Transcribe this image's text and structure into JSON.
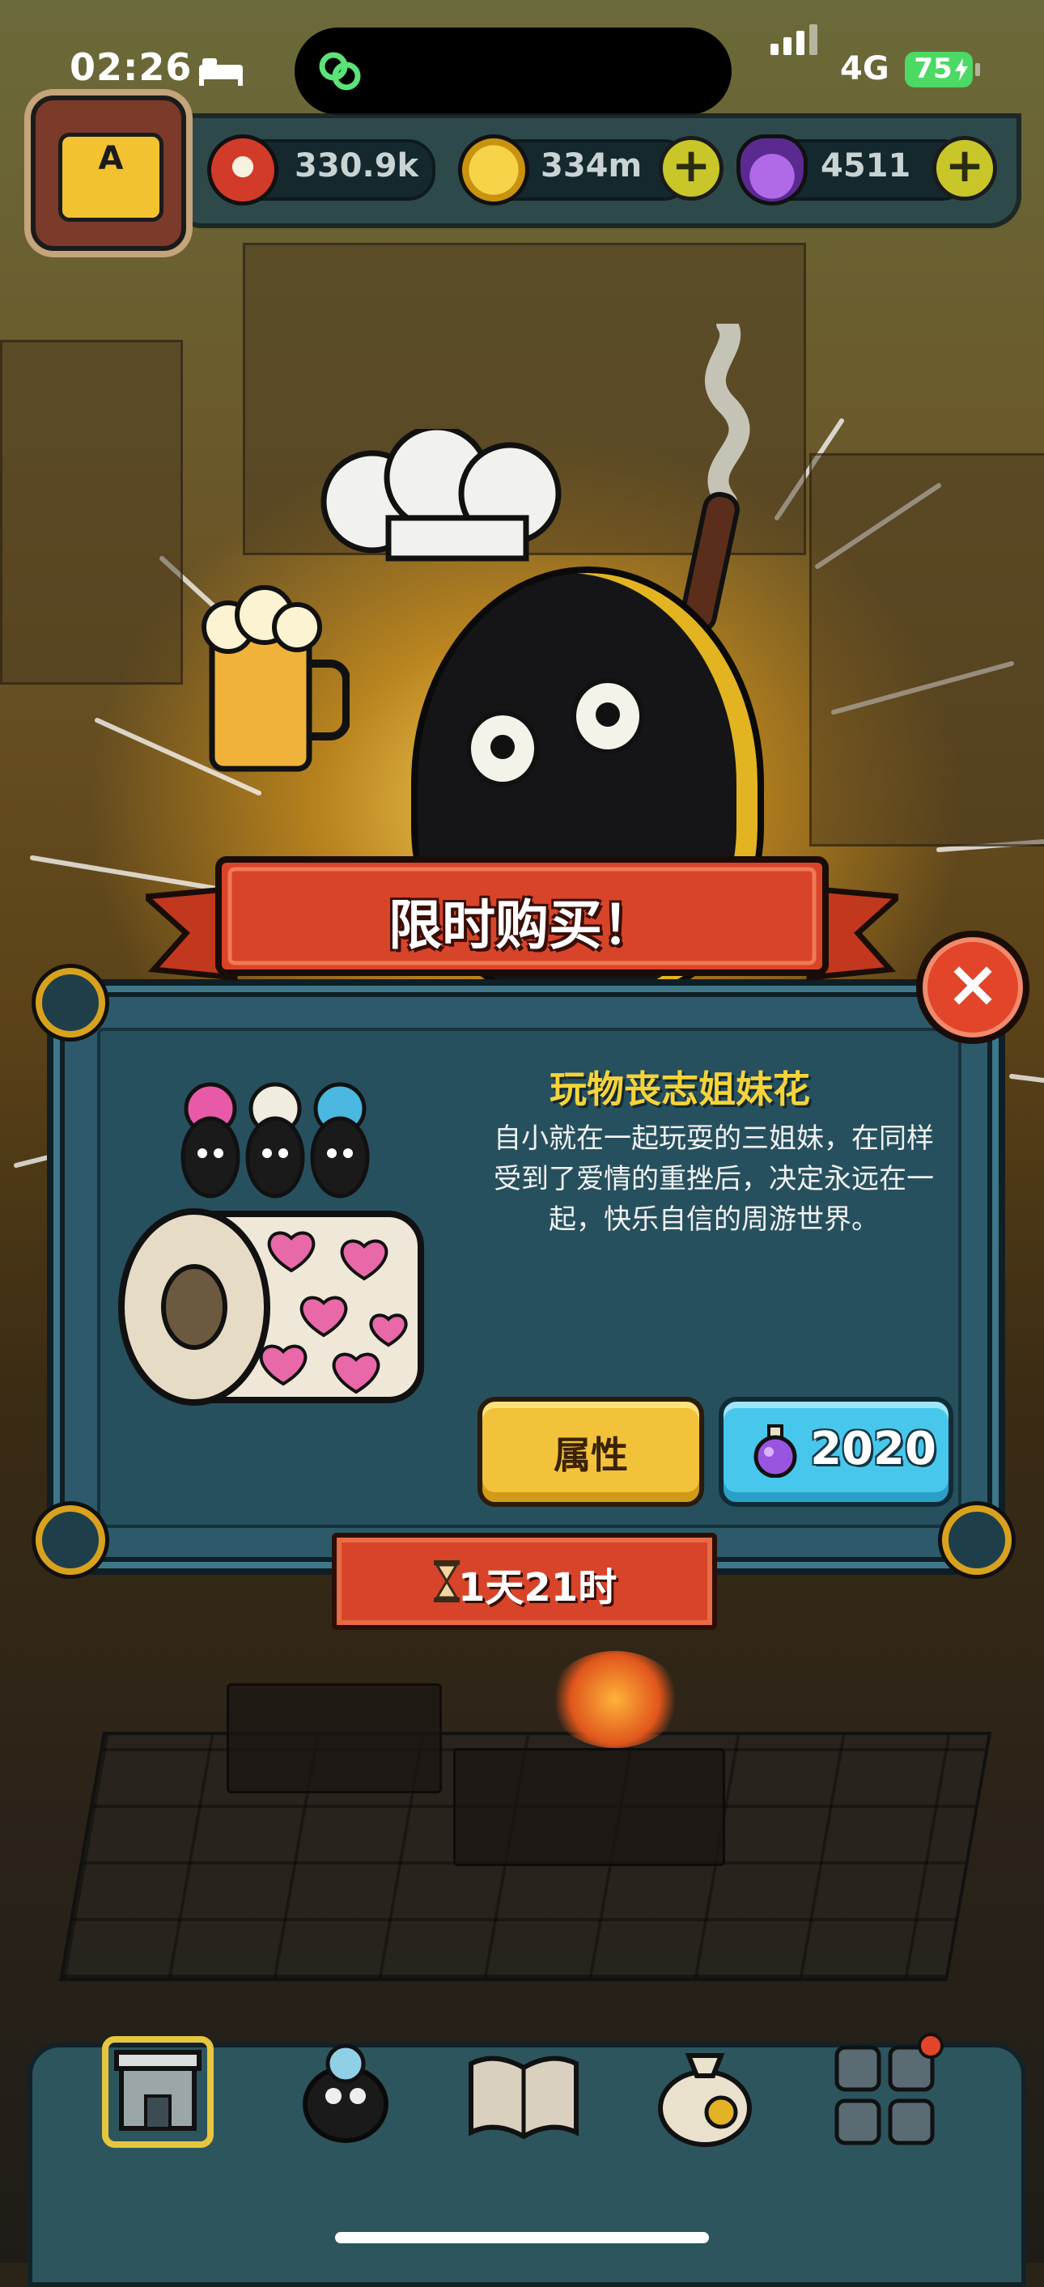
{
  "status_bar": {
    "time": "02:26",
    "network": "4G",
    "battery": "75"
  },
  "resources": {
    "eyes": "330.9k",
    "coins": "334m",
    "potions": "4511",
    "avatar_letter": "A"
  },
  "offer": {
    "banner_title": "限时购买！",
    "item_name": "玩物丧志姐妹花",
    "description": "自小就在一起玩耍的三姐妹，在同样受到了爱情的重挫后，决定永远在一起，快乐自信的周游世界。",
    "attributes_label": "属性",
    "price": "2020",
    "time_left": "1天21时"
  },
  "colors": {
    "accent_yellow": "#f5d43a",
    "panel_teal": "#2c5a6a",
    "banner_red": "#d8442a",
    "buy_blue": "#48c7ec"
  }
}
